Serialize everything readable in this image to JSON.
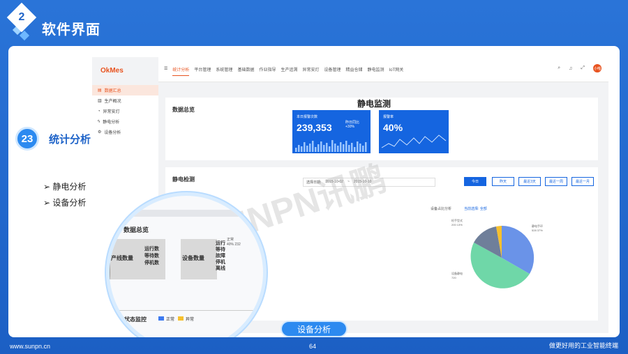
{
  "slide": {
    "badge_number": "2",
    "title": "软件界面",
    "footer_left": "www.sunpn.cn",
    "page_number": "64",
    "footer_right": "做更好用的工业智能终端"
  },
  "annotation": {
    "number": "23",
    "label": "统计分析",
    "bullets": [
      "➢  静电分析",
      "➢  设备分析"
    ]
  },
  "app": {
    "logo": "OkMes",
    "sidebar": [
      "数据汇总",
      "生产概况",
      "异常安灯",
      "静电分析",
      "设备分析"
    ],
    "nav": [
      "统计分析",
      "平台管理",
      "系统管理",
      "基础数据",
      "作业指导",
      "生产追溯",
      "异常安灯",
      "设备管理",
      "精益仓储",
      "静电监测",
      "IoT网关"
    ],
    "avatar": "小喵",
    "panel1_title": "数据总览",
    "big_title": "静电监测",
    "kpi1": {
      "label": "本日报警次数",
      "value": "239,353",
      "sub_label": "昨日同比",
      "sub_value": "+30%"
    },
    "kpi2": {
      "label": "报警率",
      "value": "40%"
    },
    "panel2_title": "静电检测",
    "date_label": "选择日期:",
    "date_from": "2015-10-02",
    "date_sep": "~",
    "date_to": "2015-10-10",
    "buttons": [
      "今日",
      "昨天",
      "最近3天",
      "最近一周",
      "最近一月"
    ],
    "pie_title": "设备占比分析",
    "pie_filter": "当前选择: 全部",
    "pie_labels": [
      {
        "name": "检手型式",
        "detail": "200  13%"
      },
      {
        "name": "静电手环",
        "detail": "528  37%"
      },
      {
        "name": "设备静电",
        "detail": "720"
      }
    ],
    "magnifier": {
      "title": "数据总览",
      "col1": "产线数量",
      "col2": [
        "运行数",
        "等待数",
        "停机数"
      ],
      "col3": "设备数量",
      "col4": [
        "运行",
        "等待",
        "故障",
        "停机",
        "离线"
      ],
      "legend_values": [
        "正常",
        "40%",
        "232"
      ],
      "status_title": "设备状态监控",
      "status_items": [
        "正常",
        "异常"
      ]
    },
    "pill": "设备分析",
    "watermark": "SUNPN讯鹏"
  },
  "colors": {
    "accent": "#e8531f",
    "brand_blue": "#1565e0",
    "slide_blue": "#1e63c8"
  }
}
